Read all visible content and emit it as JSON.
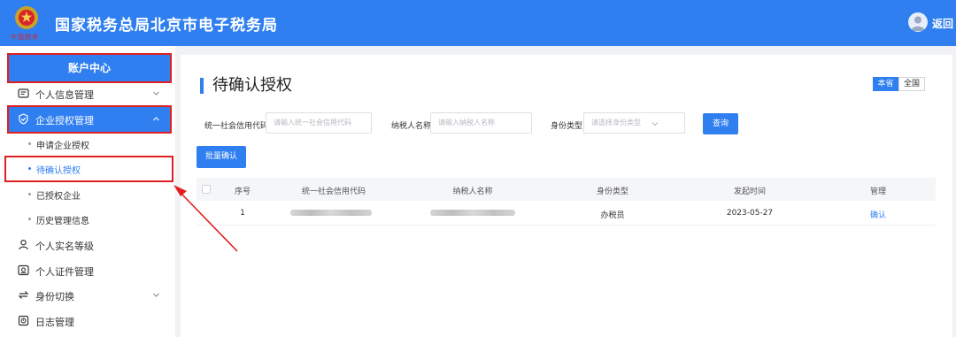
{
  "header": {
    "title": "国家税务总局北京市电子税务局",
    "emblem_caption": "中国税务",
    "back_label": "返回"
  },
  "sidebar": {
    "account_center": "账户中心",
    "items": [
      {
        "label": "个人信息管理",
        "icon": "id-card-icon",
        "expandable": true
      },
      {
        "label": "企业授权管理",
        "icon": "shield-check-icon",
        "expandable": true,
        "expanded": true
      },
      {
        "label": "个人实名等级",
        "icon": "user-icon",
        "expandable": false
      },
      {
        "label": "个人证件管理",
        "icon": "certificate-icon",
        "expandable": false
      },
      {
        "label": "身份切换",
        "icon": "switch-icon",
        "expandable": true
      },
      {
        "label": "日志管理",
        "icon": "log-icon",
        "expandable": false
      }
    ],
    "sub_items": [
      {
        "label": "申请企业授权"
      },
      {
        "label": "待确认授权",
        "selected": true
      },
      {
        "label": "已授权企业"
      },
      {
        "label": "历史管理信息"
      }
    ]
  },
  "main": {
    "title": "待确认授权",
    "scope_toggle": {
      "options": [
        "本省",
        "全国"
      ],
      "selected": "本省"
    },
    "filters": {
      "credit_code": {
        "label": "统一社会信用代码",
        "placeholder": "请输入统一社会信用代码"
      },
      "taxpayer_name": {
        "label": "纳税人名称",
        "placeholder": "请输入纳税人名称"
      },
      "identity_type": {
        "label": "身份类型",
        "placeholder": "请选择身份类型"
      }
    },
    "query_label": "查询",
    "batch_confirm_label": "批量确认",
    "table": {
      "columns": [
        "序号",
        "统一社会信用代码",
        "纳税人名称",
        "身份类型",
        "发起时间",
        "管理"
      ],
      "rows": [
        {
          "index": "1",
          "identity_type": "办税员",
          "date": "2023-05-27",
          "action": "确认"
        }
      ]
    }
  },
  "colors": {
    "primary": "#2f7ff0",
    "highlight": "#e02020"
  }
}
